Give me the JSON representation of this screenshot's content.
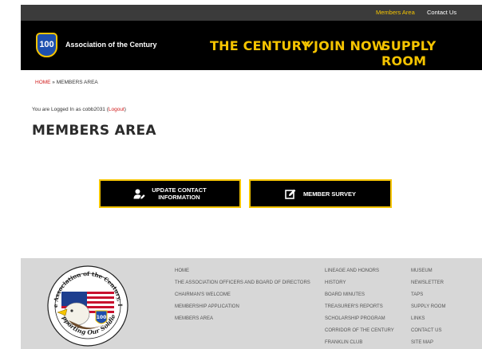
{
  "topbar": {
    "members_area": "Members Area",
    "contact_us": "Contact Us"
  },
  "header": {
    "logo_text": "100",
    "site_name": "Association of the Century",
    "nav": {
      "century": "THE CENTURY",
      "join": "JOIN NOW",
      "supply": "SUPPLY ROOM"
    }
  },
  "breadcrumb": {
    "home": "HOME",
    "separator": " » ",
    "current": "MEMBERS AREA"
  },
  "login_status": {
    "prefix": "You are Logged In as cobb2031 (",
    "logout": "Logout",
    "suffix": ")"
  },
  "page_title": "MEMBERS AREA",
  "buttons": {
    "update_line1": "UPDATE CONTACT",
    "update_line2": "INFORMATION",
    "survey": "MEMBER SURVEY"
  },
  "footer": {
    "seal_top": "The Association of the Century, Inc.",
    "seal_bottom": "Supporting Our Soldiers",
    "seal_number": "100",
    "col1": [
      "HOME",
      "THE ASSOCIATION OFFICERS AND BOARD OF DIRECTORS",
      "CHAIRMAN'S WELCOME",
      "MEMBERSHIP APPLICATION",
      "MEMBERS AREA"
    ],
    "col2": [
      "LINEAGE AND HONORS",
      "HISTORY",
      "BOARD MINUTES",
      "TREASURER'S REPORTS",
      "SCHOLARSHIP PROGRAM",
      "CORRIDOR OF THE CENTURY",
      "FRANKLIN CLUB"
    ],
    "col3": [
      "MUSEUM",
      "NEWSLETTER",
      "TAPS",
      "SUPPLY ROOM",
      "LINKS",
      "CONTACT US",
      "SITE MAP"
    ]
  },
  "colors": {
    "accent_gold": "#f5c400",
    "link_red": "#d01a1a",
    "header_black": "#000000",
    "topbar_gray": "#3b3b3b",
    "footer_gray": "#d7d7d7"
  }
}
